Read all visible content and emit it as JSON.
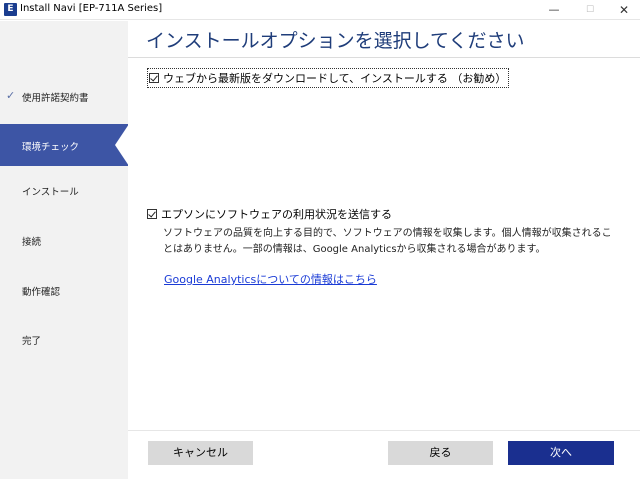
{
  "window": {
    "icon_letter": "E",
    "title": "Install Navi [EP-711A Series]",
    "minimize": "—",
    "maximize": "☐",
    "close": "✕"
  },
  "sidebar": {
    "steps": [
      {
        "label": "使用許諾契約書",
        "state": "completed",
        "check": "✓"
      },
      {
        "label": "環境チェック",
        "state": "active"
      },
      {
        "label": "インストール",
        "state": "pending"
      },
      {
        "label": "接続",
        "state": "pending"
      },
      {
        "label": "動作確認",
        "state": "pending"
      },
      {
        "label": "完了",
        "state": "pending"
      }
    ]
  },
  "main": {
    "title": "インストールオプションを選択してください",
    "option_download": {
      "label": "ウェブから最新版をダウンロードして、インストールする （お勧め）",
      "checked": true
    },
    "option_usage": {
      "label": "エプソンにソフトウェアの利用状況を送信する",
      "checked": true
    },
    "usage_description": "ソフトウェアの品質を向上する目的で、ソフトウェアの情報を収集します。個人情報が収集されることはありません。一部の情報は、Google Analyticsから収集される場合があります。",
    "ga_link": "Google Analyticsについての情報はこちら"
  },
  "footer": {
    "cancel": "キャンセル",
    "back": "戻る",
    "next": "次へ"
  },
  "colors": {
    "accent": "#3d55a5",
    "next_button": "#1a2f8f",
    "title_text": "#1f3d7a",
    "link": "#1a3bd6"
  }
}
